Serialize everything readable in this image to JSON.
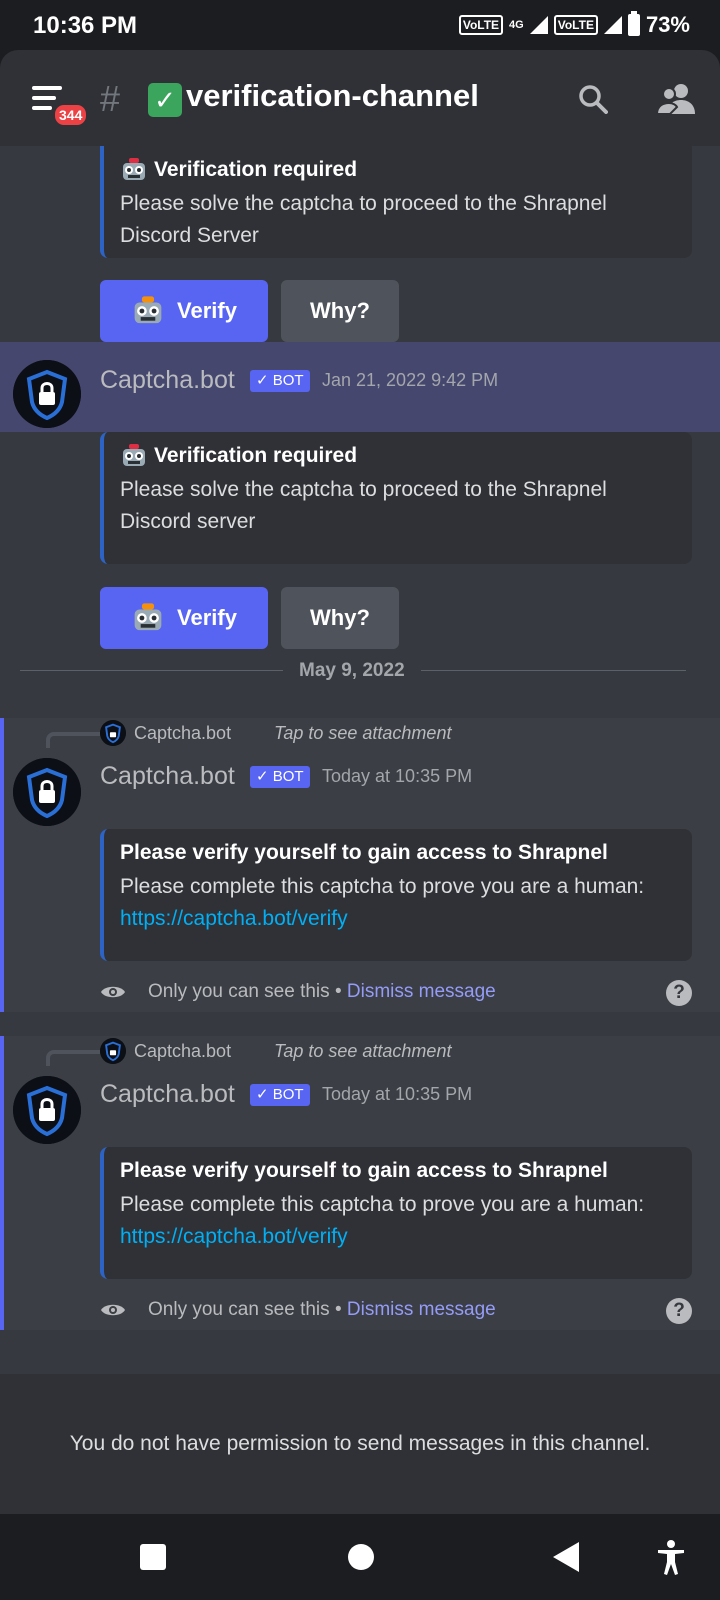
{
  "status_bar": {
    "time": "10:36 PM",
    "volte1": "VoLTE",
    "network": "4G",
    "volte2": "VoLTE",
    "battery": "73%"
  },
  "header": {
    "notification_count": "344",
    "channel_name": "verification-channel",
    "channel_emoji": "✅"
  },
  "messages": [
    {
      "embed_title": "Verification required",
      "embed_desc": "Please solve the captcha to proceed to the Shrapnel Discord Server",
      "verify_label": "Verify",
      "why_label": "Why?"
    },
    {
      "author": "Captcha.bot",
      "bot_tag": "✓ BOT",
      "timestamp": "Jan 21, 2022 9:42 PM",
      "embed_title": "Verification required",
      "embed_desc": "Please solve the captcha to proceed to the Shrapnel Discord server",
      "verify_label": "Verify",
      "why_label": "Why?"
    }
  ],
  "date_divider": "May 9, 2022",
  "ephemeral_messages": [
    {
      "reply_author": "Captcha.bot",
      "reply_text": "Tap to see attachment",
      "author": "Captcha.bot",
      "bot_tag": "✓ BOT",
      "timestamp": "Today at 10:35 PM",
      "embed_title": "Please verify yourself to gain access to Shrapnel",
      "embed_desc_pre": "Please complete this captcha to prove you are a human: ",
      "embed_link": "https://captcha.bot/verify",
      "only_you": "Only you can see this",
      "separator": "•",
      "dismiss": "Dismiss message",
      "help": "?"
    },
    {
      "reply_author": "Captcha.bot",
      "reply_text": "Tap to see attachment",
      "author": "Captcha.bot",
      "bot_tag": "✓ BOT",
      "timestamp": "Today at 10:35 PM",
      "embed_title": "Please verify yourself to gain access to Shrapnel",
      "embed_desc_pre": "Please complete this captcha to prove you are a human: ",
      "embed_link": "https://captcha.bot/verify",
      "only_you": "Only you can see this",
      "separator": "•",
      "dismiss": "Dismiss message",
      "help": "?"
    }
  ],
  "footer": {
    "no_permission": "You do not have permission to send messages in this channel."
  },
  "icons": {
    "menu": "hamburger-menu-icon",
    "search": "search-icon",
    "members": "members-icon",
    "robot": "robot-face-icon",
    "avatar": "shield-lock-icon",
    "eye": "eye-icon",
    "help": "help-circle-icon",
    "nav_recents": "square-icon",
    "nav_home": "circle-icon",
    "nav_back": "triangle-back-icon",
    "accessibility": "accessibility-icon"
  },
  "colors": {
    "blurple": "#5865f2",
    "link": "#00aff4",
    "highlight": "#45476f",
    "badge": "#ed4245"
  }
}
